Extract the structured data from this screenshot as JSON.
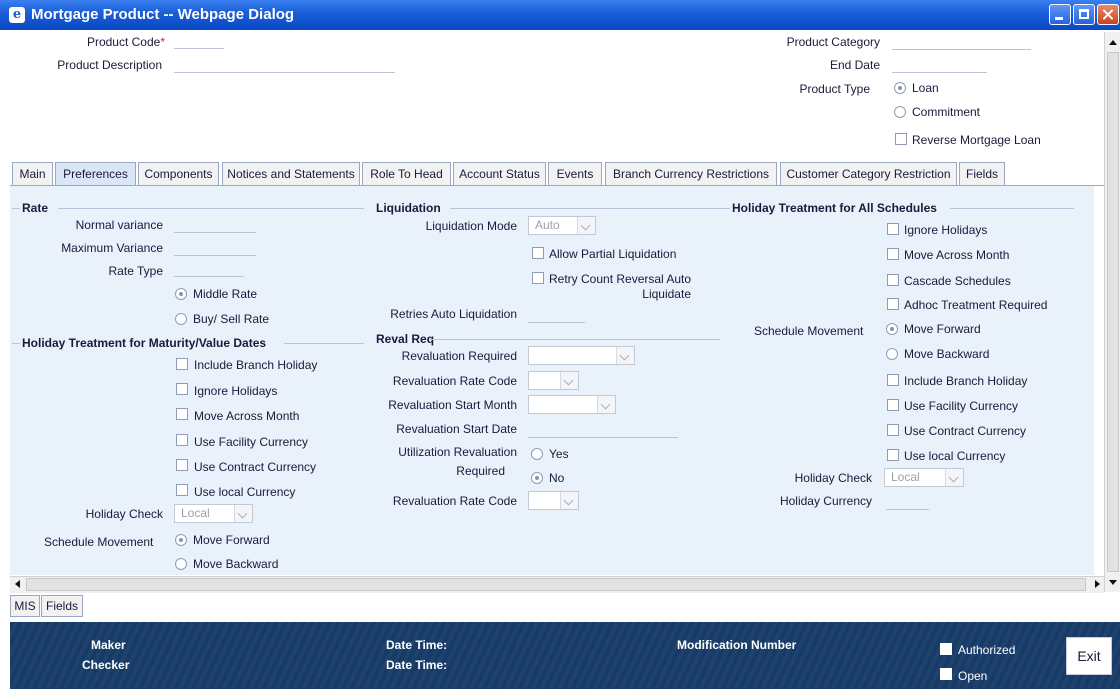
{
  "window": {
    "title": "Mortgage Product -- Webpage Dialog"
  },
  "header": {
    "product_code_label": "Product Code",
    "required_mark": "*",
    "product_description_label": "Product Description",
    "product_category_label": "Product Category",
    "end_date_label": "End Date",
    "product_type_label": "Product Type",
    "product_type_options": [
      "Loan",
      "Commitment"
    ],
    "product_type_selected": "Loan",
    "reverse_mortgage_label": "Reverse Mortgage Loan"
  },
  "tabs": [
    "Main",
    "Preferences",
    "Components",
    "Notices and Statements",
    "Role To Head",
    "Account Status",
    "Events",
    "Branch Currency Restrictions",
    "Customer Category Restriction",
    "Fields"
  ],
  "active_tab": "Preferences",
  "rate": {
    "header": "Rate",
    "normal_variance_label": "Normal variance",
    "maximum_variance_label": "Maximum Variance",
    "rate_type_label": "Rate Type",
    "rate_options": [
      "Middle Rate",
      "Buy/ Sell Rate"
    ],
    "selected": "Middle Rate"
  },
  "holiday_maturity": {
    "header": "Holiday Treatment for Maturity/Value Dates",
    "checkboxes": [
      "Include Branch Holiday",
      "Ignore Holidays",
      "Move Across Month",
      "Use Facility Currency",
      "Use Contract Currency",
      "Use local Currency"
    ],
    "holiday_check_label": "Holiday Check",
    "holiday_check_value": "Local",
    "schedule_movement_label": "Schedule Movement",
    "movement_options": [
      "Move Forward",
      "Move Backward"
    ],
    "selected": "Move Forward"
  },
  "liquidation": {
    "header": "Liquidation",
    "mode_label": "Liquidation Mode",
    "mode_value": "Auto",
    "allow_partial_label": "Allow Partial Liquidation",
    "retry_count_label_1": "Retry Count Reversal Auto",
    "retry_count_label_2": "Liquidate",
    "retries_label": "Retries Auto Liquidation"
  },
  "reval": {
    "header": "Reval Req",
    "required_label": "Revaluation Required",
    "rate_code_label": "Revaluation Rate Code",
    "start_month_label": "Revaluation Start Month",
    "start_date_label": "Revaluation Start Date",
    "utilization_label_1": "Utilization Revaluation",
    "utilization_label_2": "Required",
    "utilization_options": [
      "Yes",
      "No"
    ],
    "utilization_selected": "No",
    "rate_code_label_2": "Revaluation Rate Code"
  },
  "holiday_all": {
    "header": "Holiday Treatment for All Schedules",
    "checkboxes_top": [
      "Ignore Holidays",
      "Move Across Month",
      "Cascade Schedules",
      "Adhoc Treatment Required"
    ],
    "schedule_movement_label": "Schedule Movement",
    "movement_options": [
      "Move Forward",
      "Move Backward"
    ],
    "selected": "Move Forward",
    "checkboxes_bottom": [
      "Include Branch Holiday",
      "Use Facility Currency",
      "Use Contract Currency",
      "Use local Currency"
    ],
    "holiday_check_label": "Holiday Check",
    "holiday_check_value": "Local",
    "holiday_currency_label": "Holiday Currency"
  },
  "bottom_tabs": [
    "MIS",
    "Fields"
  ],
  "footer": {
    "maker_label": "Maker",
    "checker_label": "Checker",
    "date_time_label": "Date Time:",
    "modification_number_label": "Modification Number",
    "authorized_label": "Authorized",
    "open_label": "Open",
    "exit_label": "Exit"
  }
}
